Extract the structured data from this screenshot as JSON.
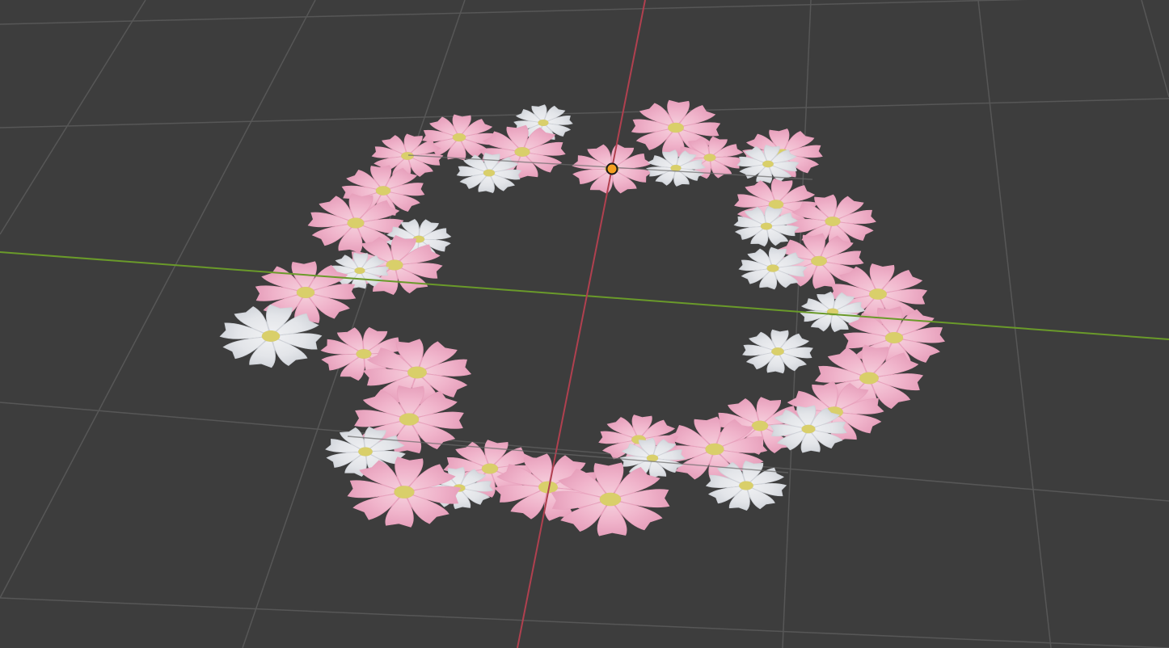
{
  "app": "3D viewport",
  "colors": {
    "background": "#3d3d3d",
    "grid": "#575757",
    "x_axis": "#b0404f",
    "y_axis": "#6a9a2a",
    "pink_petal": "#f0b4cb",
    "pink_petal_edge": "#e8a2bd",
    "white_petal": "#e3e5e9",
    "white_petal_edge": "#cfd2d8",
    "flower_center": "#d9cf6a",
    "origin_point": "#f5a020"
  },
  "scene": {
    "object": "flower-ring",
    "flower_types": [
      "pink-flower-icon",
      "white-flower-icon"
    ],
    "origin_marker": "origin-point-icon"
  }
}
